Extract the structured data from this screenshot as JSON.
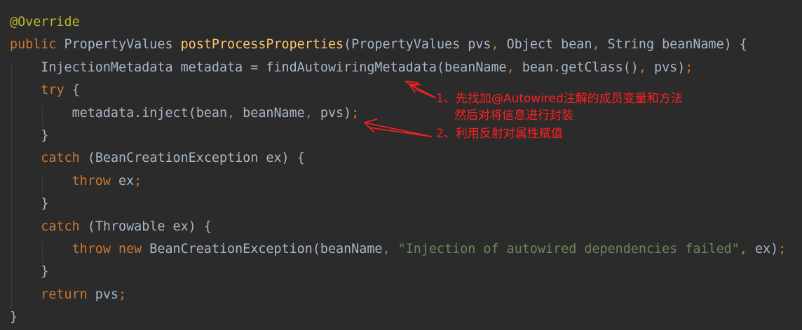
{
  "colors": {
    "background": "#2b2b2b",
    "text": "#a9b7c6",
    "keyword": "#cc7832",
    "method": "#ffc66d",
    "string": "#6a8759",
    "annotation": "#bbb529",
    "note": "#ff2020"
  },
  "code": {
    "lines": [
      [
        {
          "t": "@Override",
          "c": "annotation"
        }
      ],
      [
        {
          "t": "public",
          "c": "keyword"
        },
        {
          "t": " PropertyValues ",
          "c": "plain"
        },
        {
          "t": "postProcessProperties",
          "c": "method"
        },
        {
          "t": "(PropertyValues pvs",
          "c": "plain"
        },
        {
          "t": ",",
          "c": "keyword"
        },
        {
          "t": " Object bean",
          "c": "plain"
        },
        {
          "t": ",",
          "c": "keyword"
        },
        {
          "t": " String beanName) {",
          "c": "plain"
        }
      ],
      [
        {
          "t": "    InjectionMetadata metadata = findAutowiringMetadata(beanName",
          "c": "plain"
        },
        {
          "t": ",",
          "c": "keyword"
        },
        {
          "t": " bean.getClass()",
          "c": "plain"
        },
        {
          "t": ",",
          "c": "keyword"
        },
        {
          "t": " pvs)",
          "c": "plain"
        },
        {
          "t": ";",
          "c": "keyword"
        }
      ],
      [
        {
          "t": "    ",
          "c": "plain"
        },
        {
          "t": "try",
          "c": "keyword"
        },
        {
          "t": " {",
          "c": "plain"
        }
      ],
      [
        {
          "t": "        metadata.inject(bean",
          "c": "plain"
        },
        {
          "t": ",",
          "c": "keyword"
        },
        {
          "t": " beanName",
          "c": "plain"
        },
        {
          "t": ",",
          "c": "keyword"
        },
        {
          "t": " pvs)",
          "c": "plain"
        },
        {
          "t": ";",
          "c": "keyword"
        }
      ],
      [
        {
          "t": "    }",
          "c": "plain"
        }
      ],
      [
        {
          "t": "    ",
          "c": "plain"
        },
        {
          "t": "catch",
          "c": "keyword"
        },
        {
          "t": " (BeanCreationException ex) {",
          "c": "plain"
        }
      ],
      [
        {
          "t": "        ",
          "c": "plain"
        },
        {
          "t": "throw",
          "c": "keyword"
        },
        {
          "t": " ex",
          "c": "plain"
        },
        {
          "t": ";",
          "c": "keyword"
        }
      ],
      [
        {
          "t": "    }",
          "c": "plain"
        }
      ],
      [
        {
          "t": "    ",
          "c": "plain"
        },
        {
          "t": "catch",
          "c": "keyword"
        },
        {
          "t": " (Throwable ex) {",
          "c": "plain"
        }
      ],
      [
        {
          "t": "        ",
          "c": "plain"
        },
        {
          "t": "throw new",
          "c": "keyword"
        },
        {
          "t": " BeanCreationException(beanName",
          "c": "plain"
        },
        {
          "t": ",",
          "c": "keyword"
        },
        {
          "t": " ",
          "c": "plain"
        },
        {
          "t": "\"Injection of autowired dependencies failed\"",
          "c": "string"
        },
        {
          "t": ",",
          "c": "keyword"
        },
        {
          "t": " ex)",
          "c": "plain"
        },
        {
          "t": ";",
          "c": "keyword"
        }
      ],
      [
        {
          "t": "    }",
          "c": "plain"
        }
      ],
      [
        {
          "t": "    ",
          "c": "plain"
        },
        {
          "t": "return",
          "c": "keyword"
        },
        {
          "t": " pvs",
          "c": "plain"
        },
        {
          "t": ";",
          "c": "keyword"
        }
      ],
      [
        {
          "t": "}",
          "c": "plain"
        }
      ]
    ]
  },
  "annotations": {
    "note1_line1": "1、先找加@Autowired注解的成员变量和方法",
    "note1_line2": "然后对将信息进行封装",
    "note2": "2、利用反射对属性赋值"
  }
}
